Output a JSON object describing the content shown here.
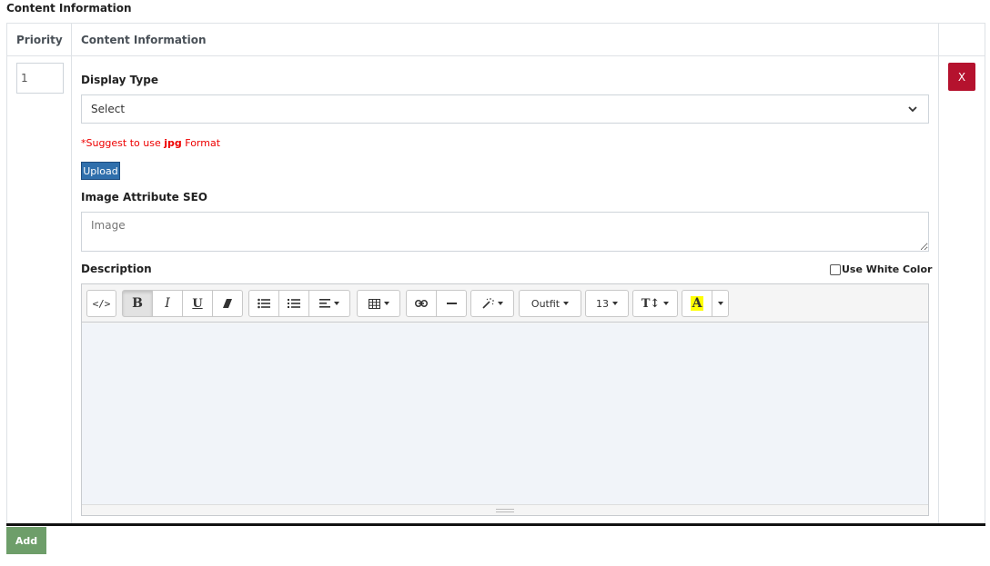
{
  "section_title": "Content Information",
  "table": {
    "headers": {
      "priority": "Priority",
      "content": "Content Information"
    },
    "row": {
      "priority_value": "1",
      "delete_label": "X",
      "display_type": {
        "label": "Display Type",
        "selected": "Select"
      },
      "hint": {
        "prefix": "*Suggest to use ",
        "format": "jpg",
        "suffix": " Format"
      },
      "upload_label": "Upload",
      "image_seo": {
        "label": "Image Attribute SEO",
        "placeholder": "Image"
      },
      "description": {
        "label": "Description",
        "white_color_label": "Use White Color",
        "white_color_checked": false
      }
    }
  },
  "editor": {
    "toolbar": {
      "code_view": "</>",
      "bold": "B",
      "italic": "I",
      "underline": "U",
      "font_name": "Outfit",
      "font_size": "13",
      "text_height": "T↕",
      "color": "A"
    }
  },
  "add_label": "Add",
  "colors": {
    "delete_button": "#b5122e",
    "upload_button": "#2f6fac",
    "add_button": "#6e9e6a",
    "hint_text": "#e00000",
    "editor_area": "#f1f4f9",
    "highlight": "#ffff00"
  }
}
